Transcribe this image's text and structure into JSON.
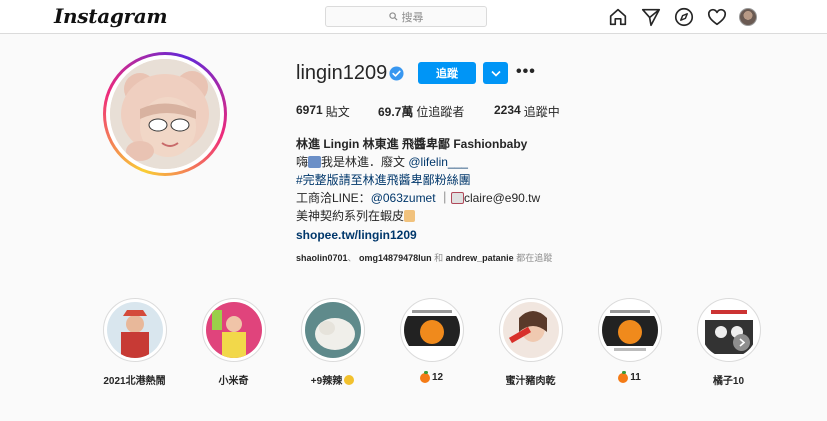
{
  "app": {
    "logo_text": "Instagram"
  },
  "search": {
    "placeholder": "搜尋"
  },
  "nav": {
    "icons": [
      "home-icon",
      "direct-icon",
      "explore-icon",
      "heart-icon",
      "profile-avatar"
    ]
  },
  "profile": {
    "username": "lingin1209",
    "verified": true,
    "follow_label": "追蹤",
    "stats": [
      {
        "value": "6971",
        "label": "貼文"
      },
      {
        "value": "69.7萬",
        "label": "位追蹤者"
      },
      {
        "value": "2234",
        "label": "追蹤中"
      }
    ],
    "bio": {
      "full_name": "林進 Lingin 林東進 飛醬卑鄙 Fashionbaby",
      "line1_prefix": "嗨",
      "line1_text": "我是林進．廢文",
      "line1_link": "@lifelin___",
      "line2": "#完整版請至林進飛醬卑鄙粉絲團",
      "line3_prefix": "工商洽LINE：",
      "line3_link": "@063zumet",
      "line3_sep": "｜",
      "line3_email": "claire@e90.tw",
      "line4": "美神契約系列在蝦皮",
      "website": "shopee.tw/lingin1209"
    },
    "followed_by": {
      "user1": "shaolin0701",
      "user2": "omg14879478lun",
      "conj": "和",
      "user3": "andrew_patanie",
      "suffix": "都在追蹤"
    }
  },
  "highlights": [
    {
      "label": "2021北港熱鬧",
      "emoji": ""
    },
    {
      "label": "小米奇",
      "emoji": ""
    },
    {
      "label": "+9辣辣",
      "emoji": "chick"
    },
    {
      "label": "12",
      "emoji": "tangerine"
    },
    {
      "label": "蜜汁豬肉乾",
      "emoji": ""
    },
    {
      "label": "11",
      "emoji": "tangerine"
    },
    {
      "label": "橘子10",
      "emoji": ""
    }
  ],
  "colors": {
    "accent": "#0095f6",
    "link": "#00376b",
    "muted": "#8e8e8e",
    "text": "#262626"
  }
}
